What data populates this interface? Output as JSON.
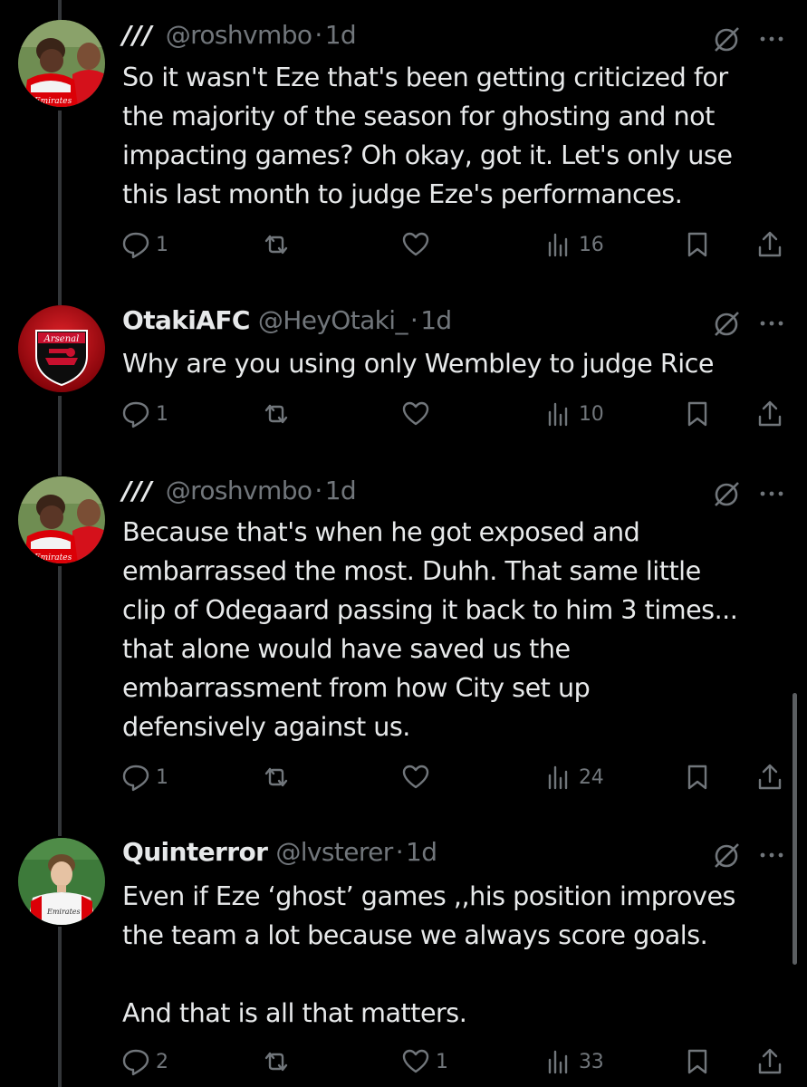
{
  "tweets": [
    {
      "name": "///",
      "handle": "@roshvmbo",
      "time": "1d",
      "text": "So it wasn't Eze that's been getting criticized for\nthe majority of the season for ghosting and not\nimpacting games? Oh okay, got it. Let's only use\nthis last month to judge Eze's performances.",
      "replies": "1",
      "retweets": "",
      "likes": "",
      "views": "16"
    },
    {
      "name": "OtakiAFC",
      "handle": "@HeyOtaki_",
      "time": "1d",
      "text": "Why are you using only Wembley to judge Rice",
      "replies": "1",
      "retweets": "",
      "likes": "",
      "views": "10"
    },
    {
      "name": "///",
      "handle": "@roshvmbo",
      "time": "1d",
      "text": "Because that's when he got exposed and\nembarrassed the most. Duhh. That same little\nclip of Odegaard passing it back to him 3 times...\nthat alone would have saved us the\nembarrassment from how City set up\ndefensively against us.",
      "replies": "1",
      "retweets": "",
      "likes": "",
      "views": "24"
    },
    {
      "name": "Quinterror",
      "handle": "@lvsterer",
      "time": "1d",
      "text": "Even if Eze ‘ghost’ games ,,his position improves\nthe team a lot because we always score goals.\n\nAnd that is all that matters.",
      "replies": "2",
      "retweets": "",
      "likes": "1",
      "views": "33"
    }
  ],
  "avatar_text": {
    "kit_sponsor": "Emirates",
    "badge": "Arsenal"
  },
  "icons": [
    "reply-icon",
    "retweet-icon",
    "like-icon",
    "views-icon",
    "bookmark-icon",
    "share-icon",
    "grok-icon",
    "more-icon"
  ],
  "colors": {
    "background": "#000000",
    "text_primary": "#e7e9ea",
    "text_secondary": "#71767b",
    "thread_line": "#333639",
    "arsenal_red": "#db0007"
  }
}
